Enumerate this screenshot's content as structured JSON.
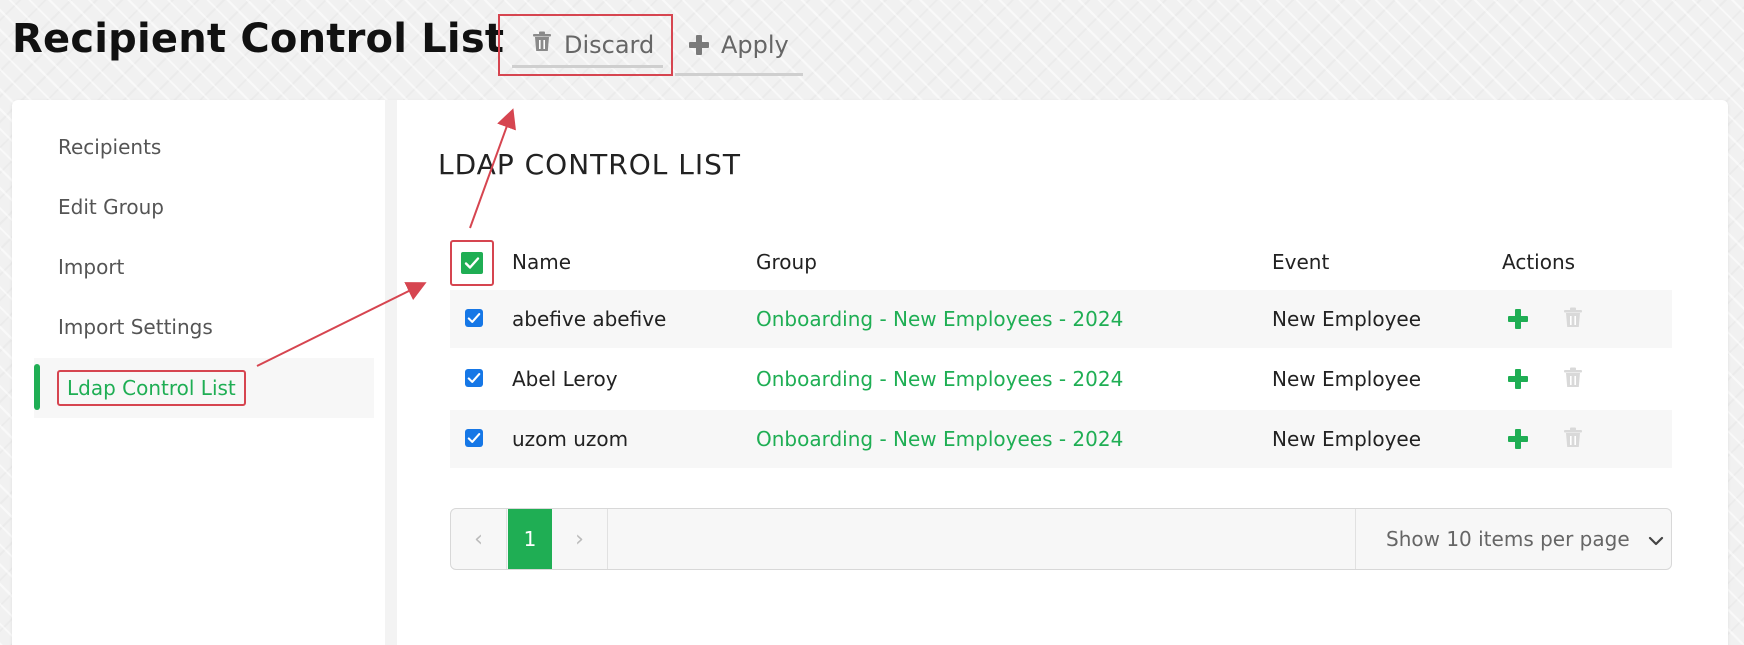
{
  "page": {
    "title": "Recipient Control List"
  },
  "toolbar": {
    "discard_label": "Discard",
    "apply_label": "Apply"
  },
  "sidebar": {
    "items": [
      {
        "label": "Recipients"
      },
      {
        "label": "Edit Group"
      },
      {
        "label": "Import"
      },
      {
        "label": "Import Settings"
      },
      {
        "label": "Ldap Control List",
        "active": true
      }
    ]
  },
  "main": {
    "section_title": "LDAP CONTROL LIST",
    "columns": [
      "Name",
      "Group",
      "Event",
      "Actions"
    ],
    "rows": [
      {
        "name": "abefive abefive",
        "group": "Onboarding - New Employees - 2024",
        "event": "New Employee",
        "checked": true
      },
      {
        "name": "Abel Leroy",
        "group": "Onboarding - New Employees - 2024",
        "event": "New Employee",
        "checked": true
      },
      {
        "name": "uzom uzom",
        "group": "Onboarding - New Employees - 2024",
        "event": "New Employee",
        "checked": true
      }
    ]
  },
  "pagination": {
    "current_page": "1",
    "items_per_page_label": "Show 10 items per page"
  },
  "colors": {
    "accent_green": "#1fae54",
    "annotation_red": "#d64550",
    "checkbox_blue": "#1677e6"
  },
  "icons": {
    "discard": "trash-icon",
    "apply": "plus-icon",
    "row_add": "plus-icon",
    "row_delete": "trash-icon",
    "pager_prev": "chevron-left-icon",
    "pager_next": "chevron-right-icon",
    "per_page_dropdown": "chevron-down-icon"
  }
}
